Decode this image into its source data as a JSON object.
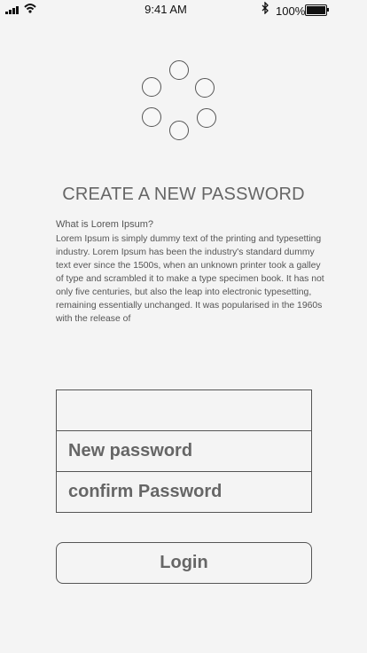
{
  "status_bar": {
    "time": "9:41 AM",
    "battery_percent": "100%",
    "icons": [
      "signal-icon",
      "wifi-icon",
      "bluetooth-icon",
      "battery-icon"
    ]
  },
  "loader": {
    "icon": "loading-spinner-icon",
    "dot_count": 6
  },
  "page": {
    "title": "CREATE A NEW PASSWORD"
  },
  "lorem": {
    "heading": "What is Lorem Ipsum?",
    "body": "Lorem Ipsum is simply dummy text of the printing and typesetting industry. Lorem Ipsum has been the industry's standard dummy text ever since the 1500s, when an unknown printer took a galley of type and scrambled it to make a type specimen book. It has not only five centuries, but also the leap into electronic typesetting, remaining essentially unchanged. It was popularised in the 1960s with the release of"
  },
  "form": {
    "top_field": {
      "value": ""
    },
    "new_password": {
      "label": "New password"
    },
    "confirm_password": {
      "label": "confirm Password"
    }
  },
  "login_button": {
    "label": "Login"
  }
}
